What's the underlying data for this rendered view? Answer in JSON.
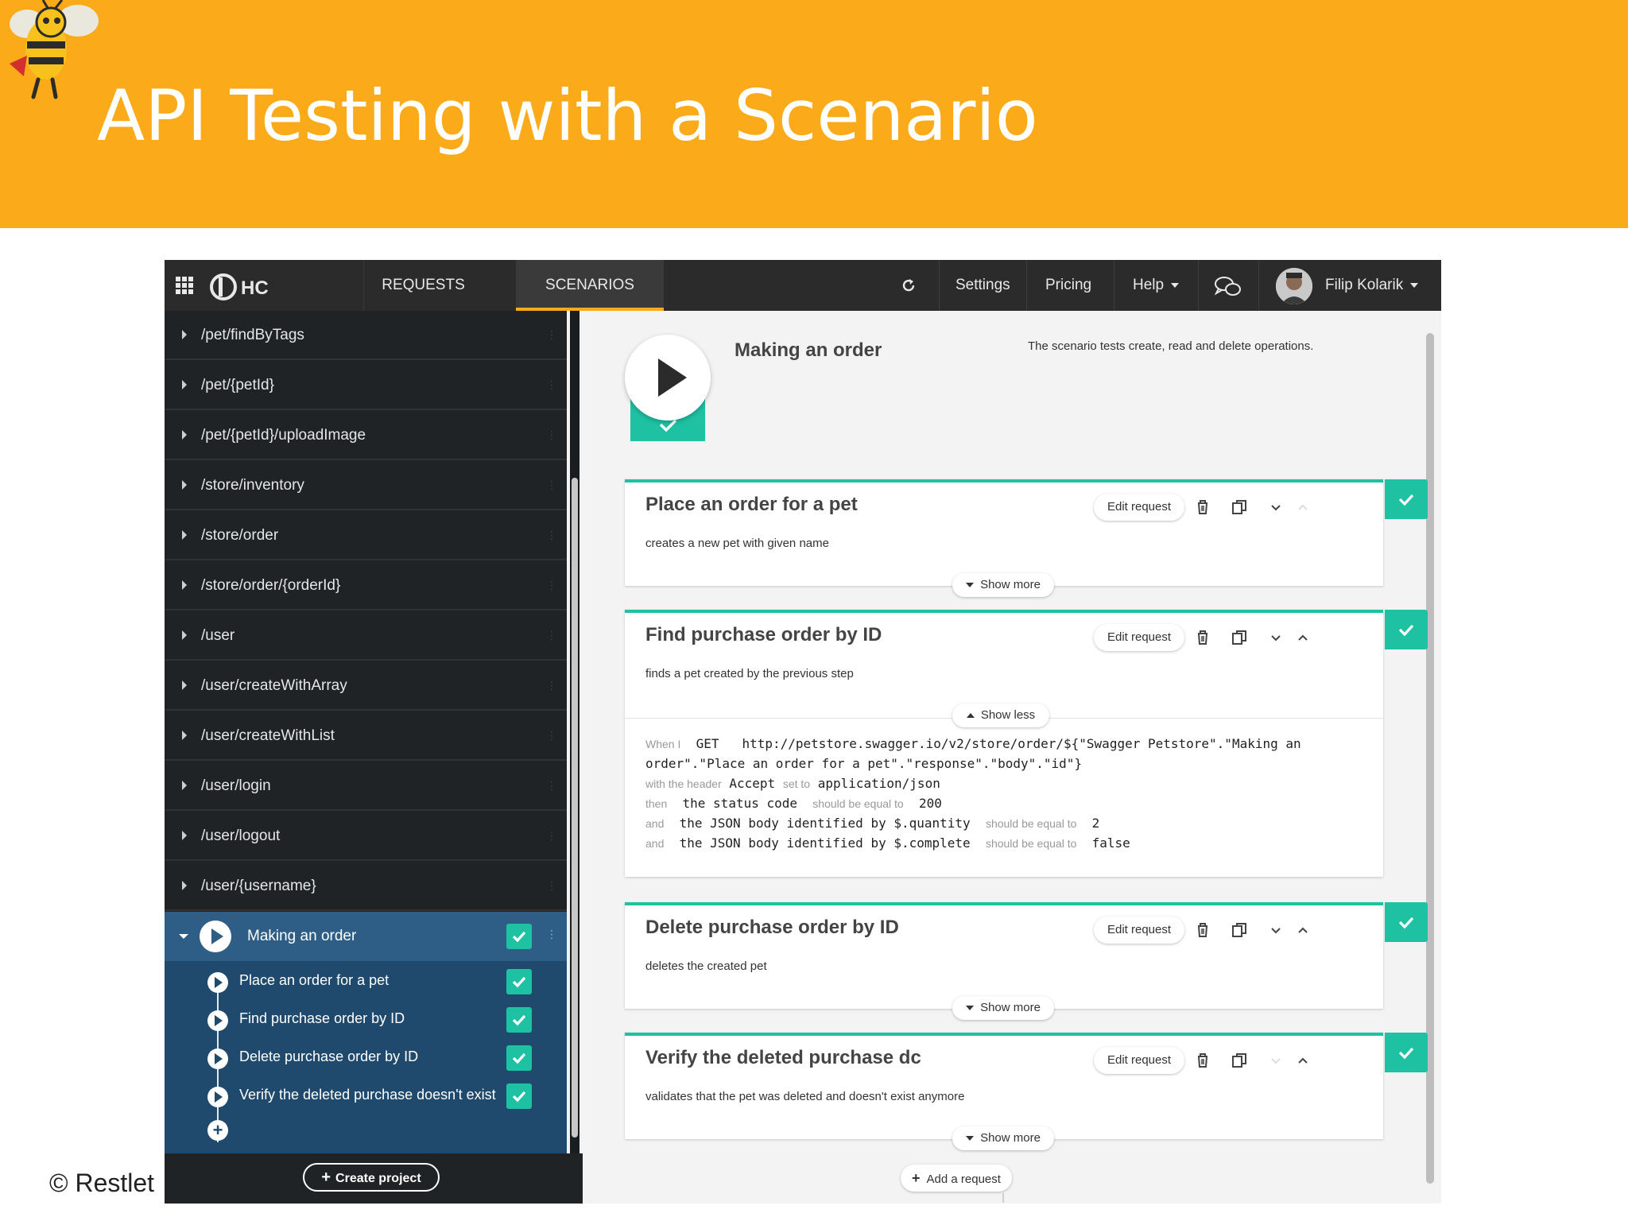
{
  "slide": {
    "title": "API Testing with a Scenario",
    "copyright": "© Restlet"
  },
  "navbar": {
    "tabs": [
      {
        "label": "REQUESTS",
        "active": false
      },
      {
        "label": "SCENARIOS",
        "active": true
      }
    ],
    "settings": "Settings",
    "pricing": "Pricing",
    "help": "Help",
    "user": "Filip Kolarik"
  },
  "sidebar": {
    "items": [
      "/pet/findByTags",
      "/pet/{petId}",
      "/pet/{petId}/uploadImage",
      "/store/inventory",
      "/store/order",
      "/store/order/{orderId}",
      "/user",
      "/user/createWithArray",
      "/user/createWithList",
      "/user/login",
      "/user/logout",
      "/user/{username}"
    ],
    "active_scenario": "Making an order",
    "steps": [
      "Place an order for a pet",
      "Find purchase order by ID",
      "Delete purchase order by ID",
      "Verify the deleted purchase doesn't exist"
    ],
    "create_project": "Create project"
  },
  "scenario": {
    "title": "Making an order",
    "description": "The scenario tests create, read and delete operations."
  },
  "cards": [
    {
      "title": "Place an order for a pet",
      "description": "creates a new pet with given name",
      "edit": "Edit request",
      "toggle": "Show more"
    },
    {
      "title": "Find purchase order by ID",
      "description": "finds a pet created by the previous step",
      "edit": "Edit request",
      "toggle": "Show less"
    },
    {
      "title": "Delete purchase order by ID",
      "description": "deletes the created pet",
      "edit": "Edit request",
      "toggle": "Show more"
    },
    {
      "title": "Verify the deleted purchase dc",
      "description": "validates that the pet was deleted and doesn't exist anymore",
      "edit": "Edit request",
      "toggle": "Show more"
    }
  ],
  "details": {
    "when_kw": "When I",
    "method": "GET",
    "url": "http://petstore.swagger.io/v2/store/order/${\"Swagger Petstore\".\"Making an",
    "url_cont": "order\".\"Place an order for a pet\".\"response\".\"body\".\"id\"}",
    "header_kw": "with the header",
    "header_name": "Accept",
    "set_to": "set to",
    "header_value": "application/json",
    "then_kw": "then",
    "status_subject": "the status code",
    "should_eq": "should be equal to",
    "status_value": "200",
    "and_kw": "and",
    "qty_subject": "the JSON body identified by $.quantity",
    "qty_value": "2",
    "complete_subject": "the JSON body identified by $.complete",
    "complete_value": "false"
  },
  "add_request": "Add a request",
  "colors": {
    "accent": "#fbab19",
    "success": "#1fc1a3",
    "active_blue": "#2e5e86",
    "nav_bg": "#2b2b2b"
  }
}
